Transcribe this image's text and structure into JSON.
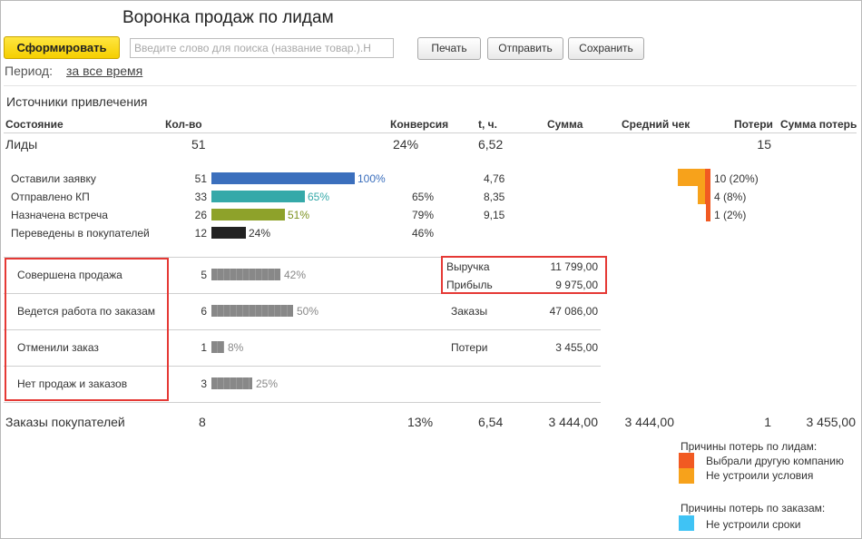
{
  "title": "Воронка продаж по лидам",
  "toolbar": {
    "generate_label": "Сформировать",
    "search_placeholder": "Введите слово для поиска (название товар.).Н",
    "search_value": "",
    "print_label": "Печать",
    "send_label": "Отправить",
    "save_label": "Сохранить"
  },
  "period": {
    "label": "Период:",
    "value": "за все время"
  },
  "group_title": "Источники привлечения",
  "columns": {
    "state": "Состояние",
    "count": "Кол-во",
    "conversion": "Конверсия",
    "t": "t, ч.",
    "sum": "Сумма",
    "avg_check": "Средний чек",
    "losses": "Потери",
    "loss_sum": "Сумма потерь"
  },
  "leads_row": {
    "label": "Лиды",
    "count": "51",
    "conversion": "24%",
    "t": "6,52",
    "losses": "15"
  },
  "stages": [
    {
      "label": "Оставили заявку",
      "count": "51",
      "pct_label": "100%",
      "fraction": 1.0,
      "color": "#3b6fbd",
      "pct_color": "#3b6fbd",
      "conversion": "",
      "t": "4,76",
      "losses": "10 (20%)"
    },
    {
      "label": "Отправлено КП",
      "count": "33",
      "pct_label": "65%",
      "fraction": 0.65,
      "color": "#35a9a9",
      "pct_color": "#35a9a9",
      "conversion": "65%",
      "t": "8,35",
      "losses": "4 (8%)"
    },
    {
      "label": "Назначена встреча",
      "count": "26",
      "pct_label": "51%",
      "fraction": 0.51,
      "color": "#8ea22a",
      "pct_color": "#7d9220",
      "conversion": "79%",
      "t": "9,15",
      "losses": "1 (2%)"
    },
    {
      "label": "Переведены в покупателей",
      "count": "12",
      "pct_label": "24%",
      "fraction": 0.24,
      "color": "#222222",
      "pct_color": "#333333",
      "conversion": "46%",
      "t": "",
      "losses": ""
    }
  ],
  "outcomes": [
    {
      "label": "Совершена продажа",
      "count": "5",
      "pct_label": "42%",
      "fraction": 0.42,
      "metric_label": "Выручка",
      "metric_value": "11 799,00",
      "metric2_label": "Прибыль",
      "metric2_value": "9 975,00"
    },
    {
      "label": "Ведется работа по заказам",
      "count": "6",
      "pct_label": "50%",
      "fraction": 0.5,
      "metric_label": "Заказы",
      "metric_value": "47 086,00"
    },
    {
      "label": "Отменили заказ",
      "count": "1",
      "pct_label": "8%",
      "fraction": 0.08,
      "metric_label": "Потери",
      "metric_value": "3 455,00"
    },
    {
      "label": "Нет продаж и заказов",
      "count": "3",
      "pct_label": "25%",
      "fraction": 0.25,
      "metric_label": "",
      "metric_value": ""
    }
  ],
  "orders_row": {
    "label": "Заказы покупателей",
    "count": "8",
    "conversion": "13%",
    "t": "6,54",
    "sum": "3 444,00",
    "avg_check": "3 444,00",
    "losses": "1",
    "loss_sum": "3 455,00"
  },
  "legend": {
    "leads_title": "Причины потерь по лидам:",
    "leads_items": [
      {
        "label": "Выбрали другую компанию",
        "color": "#f15a22"
      },
      {
        "label": "Не устроили условия",
        "color": "#f7a21b"
      }
    ],
    "orders_title": "Причины потерь по заказам:",
    "orders_items": [
      {
        "label": "Не устроили сроки",
        "color": "#3fc3f5"
      }
    ]
  },
  "colors": {
    "accent_button": "#f7d300",
    "highlight_box": "#e53935",
    "gray_bar": "#888888"
  }
}
